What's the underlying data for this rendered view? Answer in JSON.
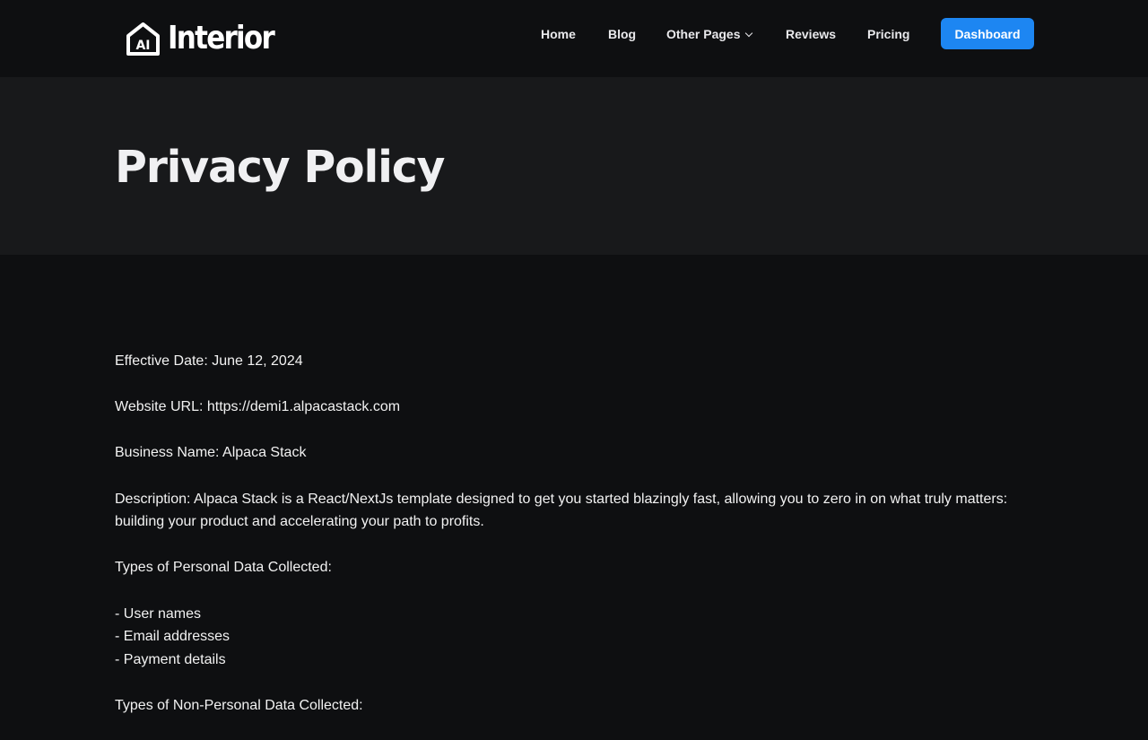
{
  "header": {
    "logo_badge": "AI",
    "logo_text": "Interior",
    "nav": [
      {
        "label": "Home"
      },
      {
        "label": "Blog"
      },
      {
        "label": "Other Pages"
      },
      {
        "label": "Reviews"
      },
      {
        "label": "Pricing"
      }
    ],
    "cta_label": "Dashboard",
    "cta_color": "#1d86f2"
  },
  "hero": {
    "title": "Privacy Policy"
  },
  "policy": {
    "effective_date": "Effective Date: June 12, 2024",
    "website_url": "Website URL: https://demi1.alpacastack.com",
    "business_name": "Business Name: Alpaca Stack",
    "description": "Description: Alpaca Stack is a React/NextJs template designed to get you started blazingly fast, allowing you to zero in on what truly matters: building your product and accelerating your path to profits.",
    "personal_heading": "Types of Personal Data Collected:",
    "personal_items": [
      "- User names",
      "- Email addresses",
      "- Payment details"
    ],
    "non_personal_heading": "Types of Non-Personal Data Collected:"
  },
  "colors": {
    "page_bg": "#0e0f11",
    "hero_bg": "#18191b",
    "accent": "#1d86f2"
  }
}
